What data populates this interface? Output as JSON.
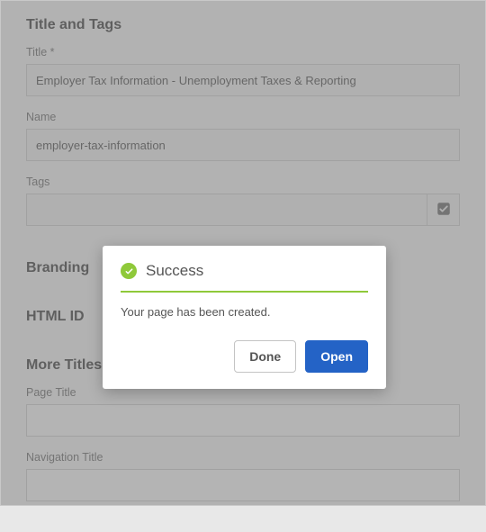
{
  "sections": {
    "title_and_tags": "Title and Tags",
    "branding": "Branding",
    "html_id": "HTML ID",
    "more_titles": "More Titles and Description"
  },
  "fields": {
    "title_label": "Title *",
    "title_value": "Employer Tax Information - Unemployment Taxes & Reporting",
    "name_label": "Name",
    "name_value": "employer-tax-information",
    "tags_label": "Tags",
    "tags_value": "",
    "page_title_label": "Page Title",
    "page_title_value": "",
    "nav_title_label": "Navigation Title",
    "nav_title_value": ""
  },
  "dialog": {
    "title": "Success",
    "message": "Your page has been created.",
    "done_label": "Done",
    "open_label": "Open"
  }
}
